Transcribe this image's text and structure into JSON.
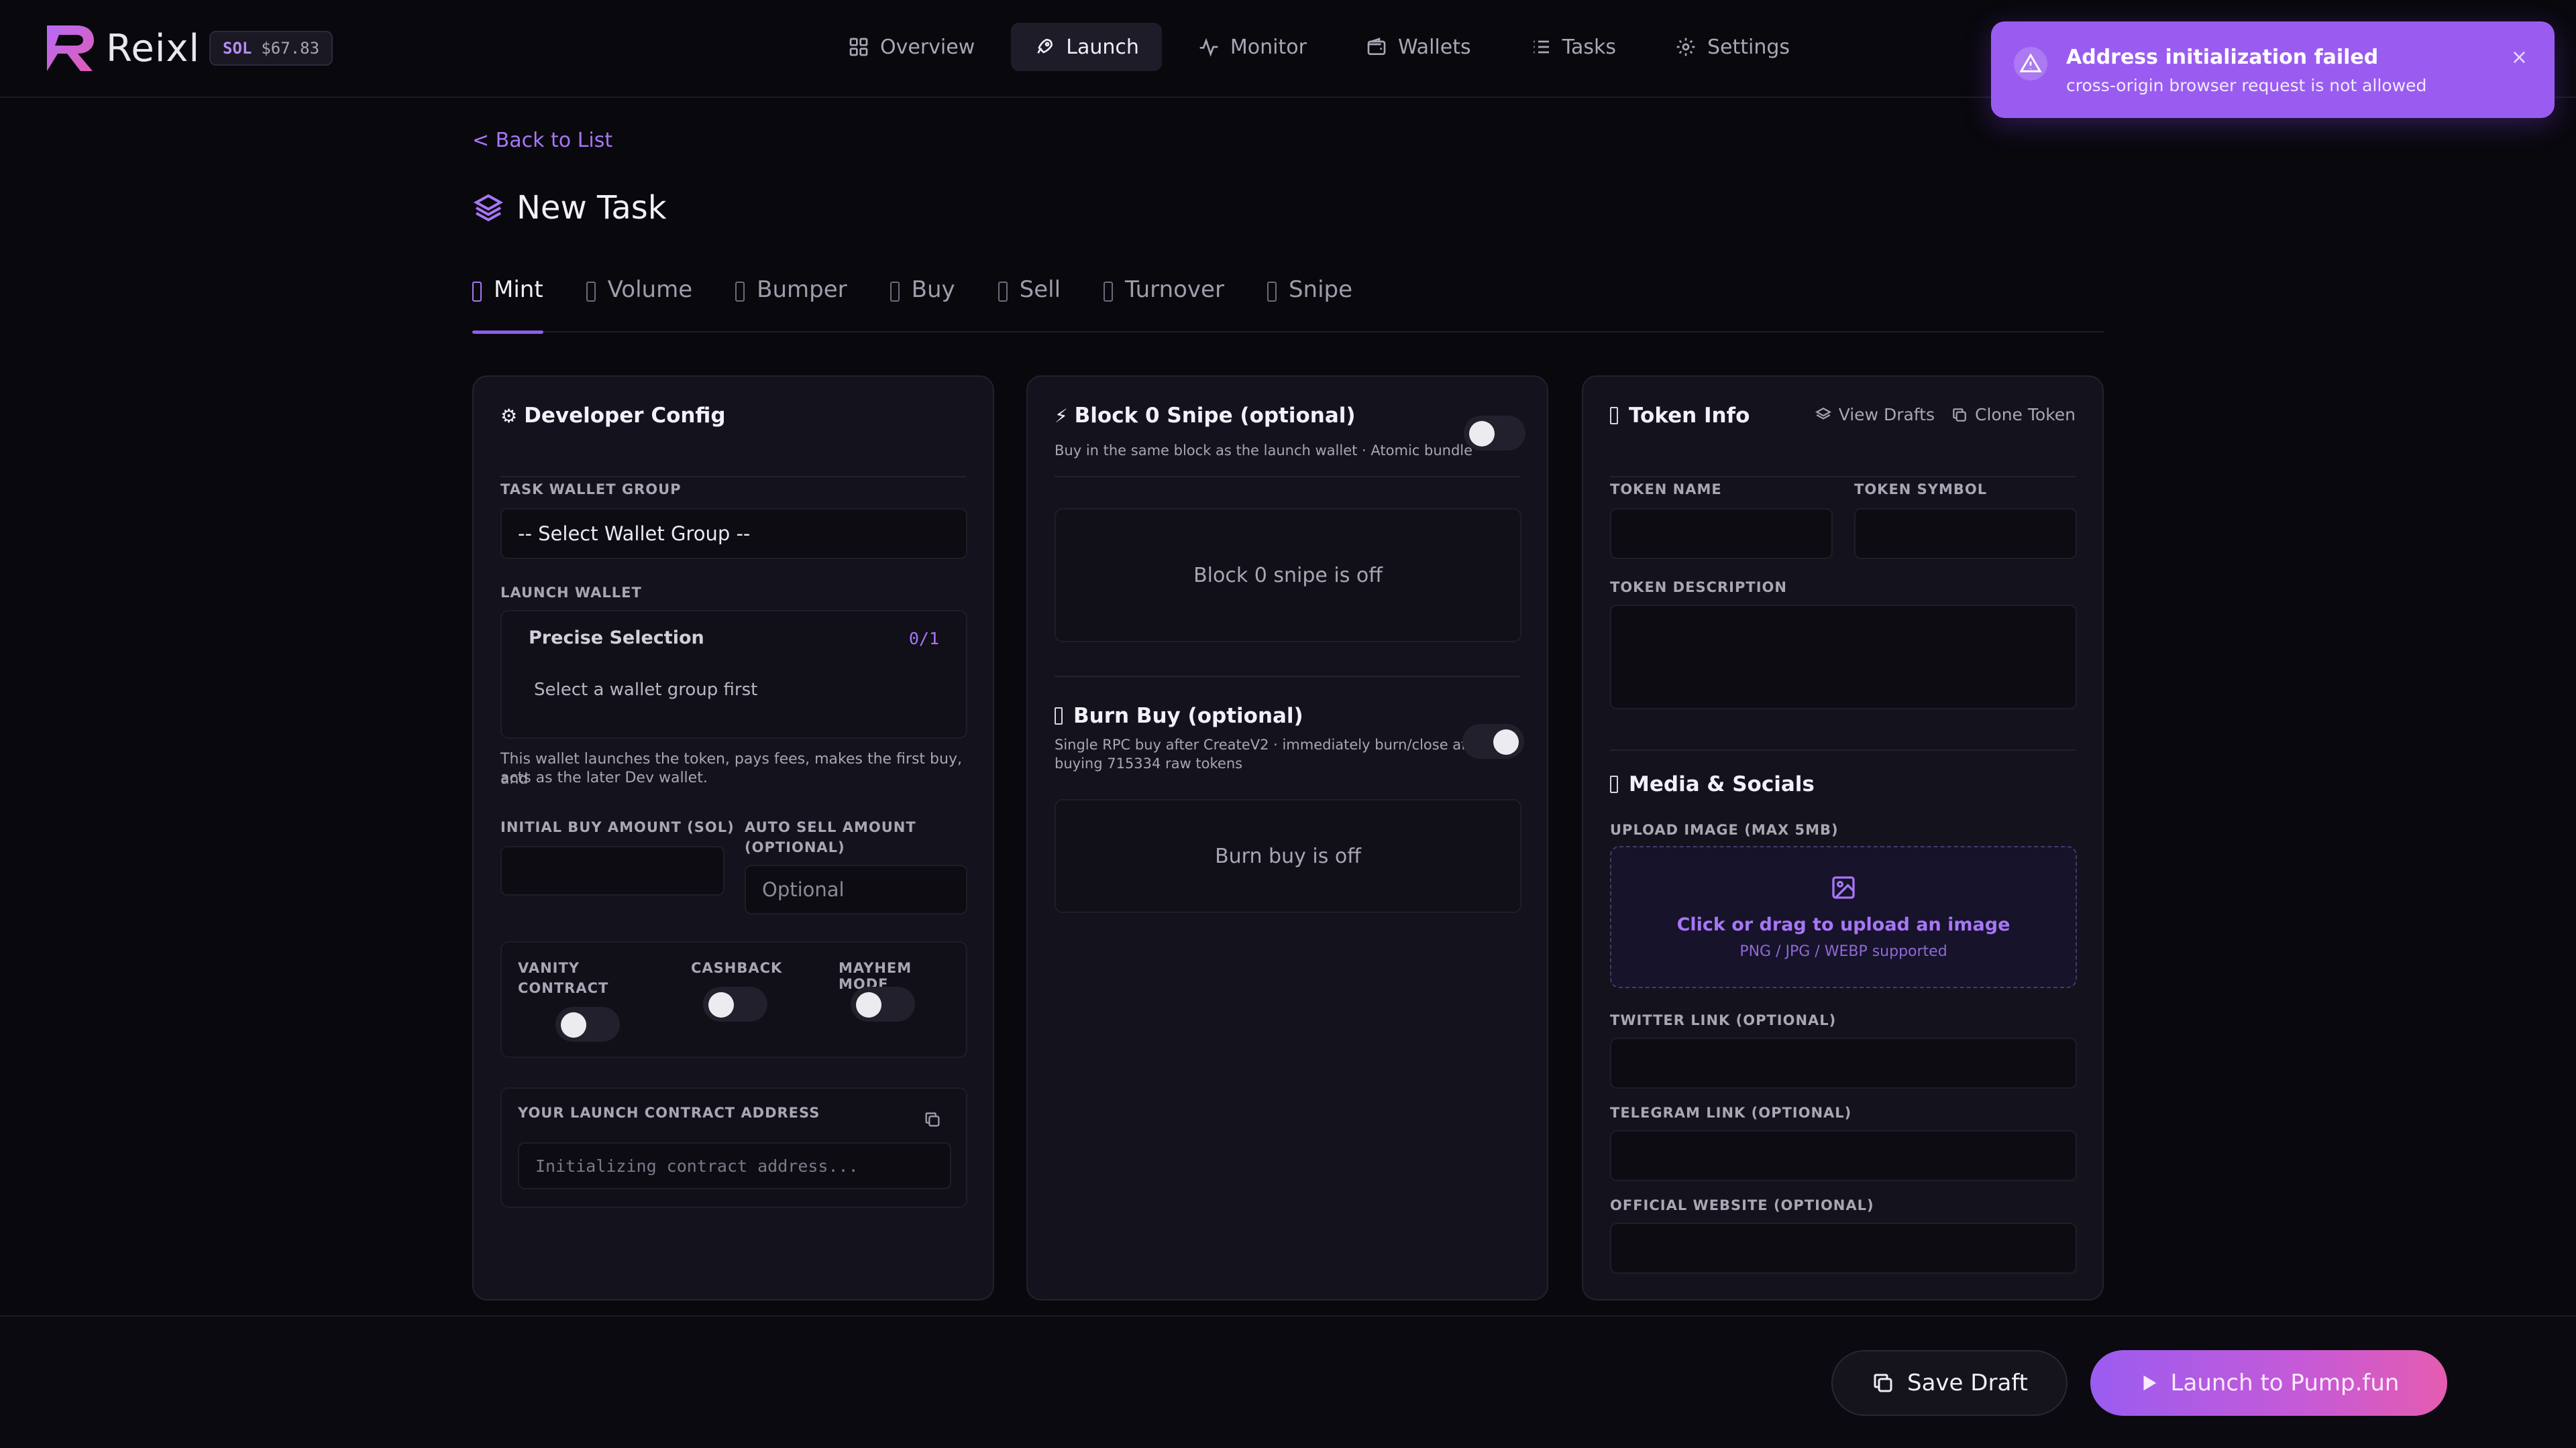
{
  "app": {
    "name": "Reixl"
  },
  "sol_badge": {
    "symbol": "SOL",
    "price": "$67.83"
  },
  "nav": [
    {
      "label": "Overview",
      "icon": "grid-icon"
    },
    {
      "label": "Launch",
      "icon": "rocket-icon",
      "active": true
    },
    {
      "label": "Monitor",
      "icon": "activity-icon"
    },
    {
      "label": "Wallets",
      "icon": "wallet-icon"
    },
    {
      "label": "Tasks",
      "icon": "list-icon"
    },
    {
      "label": "Settings",
      "icon": "gear-icon"
    }
  ],
  "toast": {
    "title": "Address initialization failed",
    "message": "cross-origin browser request is not allowed",
    "close": "×"
  },
  "back_link": "< Back to List",
  "page_title": "New Task",
  "tabs": [
    {
      "label": "Mint",
      "active": true
    },
    {
      "label": "Volume"
    },
    {
      "label": "Bumper"
    },
    {
      "label": "Buy"
    },
    {
      "label": "Sell"
    },
    {
      "label": "Turnover"
    },
    {
      "label": "Snipe"
    }
  ],
  "developer_config": {
    "title": "Developer Config",
    "wallet_group_label": "TASK WALLET GROUP",
    "wallet_group_value": "-- Select Wallet Group --",
    "launch_wallet_label": "LAUNCH WALLET",
    "precise_selection": "Precise Selection",
    "selection_count": "0/1",
    "select_hint": "Select a wallet group first",
    "wallet_note_1": "This wallet launches the token, pays fees, makes the first buy, and",
    "wallet_note_2": "acts as the later Dev wallet.",
    "initial_buy_label": "INITIAL BUY AMOUNT (SOL)",
    "initial_buy_value": "",
    "auto_sell_label_1": "AUTO SELL AMOUNT",
    "auto_sell_label_2": "(OPTIONAL)",
    "auto_sell_placeholder": "Optional",
    "vanity_label_1": "VANITY",
    "vanity_label_2": "CONTRACT",
    "cashback_label": "CASHBACK",
    "mayhem_label": "MAYHEM MODE",
    "vanity_on": false,
    "cashback_on": false,
    "mayhem_on": false,
    "contract_address_label": "YOUR LAUNCH CONTRACT ADDRESS",
    "contract_address_placeholder": "Initializing contract address..."
  },
  "block0": {
    "title": "Block 0 Snipe (optional)",
    "subtitle": "Buy in the same block as the launch wallet · Atomic bundle",
    "enabled": false,
    "status": "Block 0 snipe is off"
  },
  "burn_buy": {
    "title": "Burn Buy (optional)",
    "subtitle_1": "Single RPC buy after CreateV2 · immediately burn/close after",
    "subtitle_2": "buying 715334 raw tokens",
    "enabled": false,
    "status": "Burn buy is off"
  },
  "token_info": {
    "title": "Token Info",
    "view_drafts": "View Drafts",
    "clone_token": "Clone Token",
    "name_label": "TOKEN NAME",
    "symbol_label": "TOKEN SYMBOL",
    "description_label": "TOKEN DESCRIPTION",
    "media_title": "Media & Socials",
    "upload_label": "UPLOAD IMAGE (MAX 5MB)",
    "upload_cta": "Click or drag to upload an image",
    "upload_formats": "PNG / JPG / WEBP supported",
    "twitter_label": "TWITTER LINK (OPTIONAL)",
    "telegram_label": "TELEGRAM LINK (OPTIONAL)",
    "website_label": "OFFICIAL WEBSITE (OPTIONAL)"
  },
  "footer": {
    "save_draft": "Save Draft",
    "launch": "Launch to Pump.fun"
  },
  "colors": {
    "accent": "#9a5cf0",
    "background": "#09080d",
    "panel": "#14121c",
    "toast": "#9a5cf0"
  }
}
